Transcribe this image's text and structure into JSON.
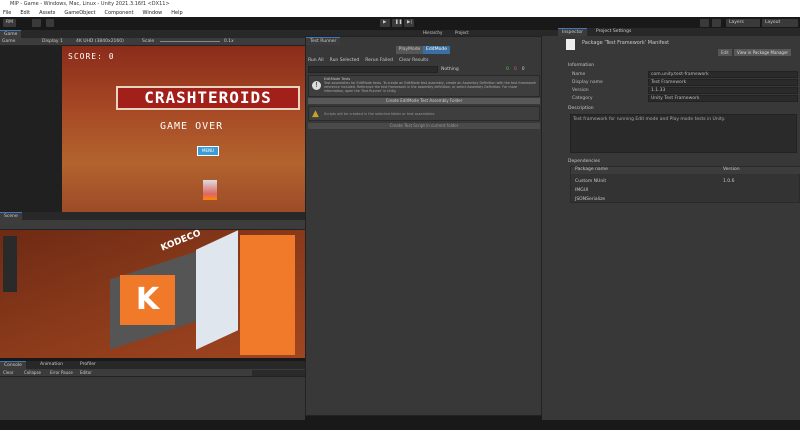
{
  "window": {
    "title": "MIP - Game - Windows, Mac, Linux - Unity 2021.3.16f1 <DX11>"
  },
  "menu": [
    "File",
    "Edit",
    "Assets",
    "GameObject",
    "Component",
    "Window",
    "Help"
  ],
  "toolbar": {
    "account": "RM",
    "layers": "Layers",
    "layout": "Layout"
  },
  "game": {
    "tab": "Game",
    "mode": "Game",
    "display": "Display 1",
    "resolution": "4K UHD (3840x2160)",
    "scale_label": "Scale",
    "scale_value": "0.1x",
    "score": "SCORE: 0",
    "logo": "CRASHTEROIDS",
    "gameover": "GAME OVER",
    "button": "MENU"
  },
  "scene": {
    "tab": "Scene",
    "sign": "KODECO"
  },
  "console": {
    "tabs": [
      "Console",
      "Animation",
      "Profiler"
    ],
    "clear": "Clear",
    "collapse": "Collapse",
    "error_pause": "Error Pause",
    "editor": "Editor"
  },
  "hierarchy": {
    "tabs": [
      "Hierarchy",
      "Project"
    ]
  },
  "test_runner": {
    "title": "Test Runner",
    "modes": [
      "PlayMode",
      "EditMode"
    ],
    "actions": [
      "Run All",
      "Run Selected",
      "Rerun Failed",
      "Clear Results"
    ],
    "search_placeholder": "",
    "filter": "Nothing",
    "counts": [
      "0",
      "0",
      "0"
    ],
    "info_title": "EditMode Tests",
    "info_text": "Test assemblies for EditMode tests. To create an EditMode test assembly, create an Assembly Definition with the test framework reference included. Reference the test framework in the assembly definition, or select Assembly Definition. For more information, open the 'Test Runner' in Unity.",
    "create_folder": "Create EditMode Test Assembly Folder",
    "warning": "Scripts will be created in the selected folder or test assemblies.",
    "create_script": "Create Test Script in current folder"
  },
  "inspector": {
    "tabs": [
      "Inspector",
      "Project Settings"
    ],
    "header": "Package 'Test Framework' Manifest",
    "edit": "Edit",
    "view_pm": "View in Package Manager",
    "section_info": "Information",
    "fields": [
      {
        "label": "Name",
        "value": "com.unity.test-framework"
      },
      {
        "label": "Display name",
        "value": "Test Framework"
      },
      {
        "label": "Version",
        "value": "1.1.33"
      },
      {
        "label": "Category",
        "value": "Unity Test Framework"
      }
    ],
    "description_label": "Description",
    "description": "Test framework for running Edit mode and Play mode tests in Unity.",
    "dependencies_label": "Dependencies",
    "dep_headers": [
      "Package name",
      "Version"
    ],
    "deps": [
      {
        "name": "Custom NUnit",
        "version": "1.0.6"
      },
      {
        "name": "IMGUI",
        "version": ""
      },
      {
        "name": "JSONSerialize",
        "version": ""
      }
    ]
  }
}
